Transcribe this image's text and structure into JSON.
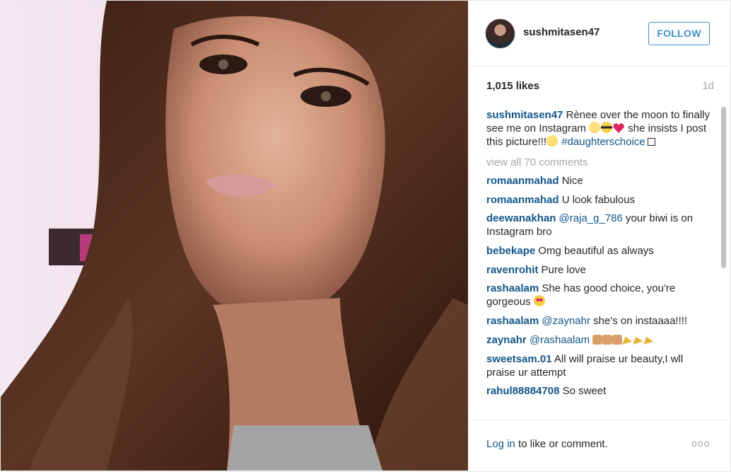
{
  "post": {
    "username": "sushmitasen47",
    "follow_label": "FOLLOW",
    "likes": "1,015 likes",
    "age": "1d",
    "caption": {
      "username": "sushmitasen47",
      "text_1": "Rènee over the moon to finally see me on Instagram ",
      "text_2": " she insists I post this picture!!!",
      "hashtag": "#daughterschoice"
    },
    "view_all": "view all 70 comments"
  },
  "comments": [
    {
      "user": "romaanmahad",
      "text": "Nice"
    },
    {
      "user": "romaanmahad",
      "text": "U look fabulous"
    },
    {
      "user": "deewanakhan",
      "mention": "@raja_g_786",
      "text": " your biwi is on Instagram bro"
    },
    {
      "user": "bebekape",
      "text": "Omg beautiful as always"
    },
    {
      "user": "ravenrohit",
      "text": "Pure love"
    },
    {
      "user": "rashaalam",
      "text": "She has good choice, you're gorgeous "
    },
    {
      "user": "rashaalam",
      "mention": "@zaynahr",
      "text": " she's on instaaaa!!!!"
    },
    {
      "user": "zaynahr",
      "mention": "@rashaalam",
      "text": " "
    },
    {
      "user": "sweetsam.01",
      "text": "All will praise ur beauty,I wll praise ur attempt"
    },
    {
      "user": "rahul88884708",
      "text": "So sweet"
    }
  ],
  "footer": {
    "login_link": "Log in",
    "login_text": " to like or comment.",
    "more": "ooo"
  },
  "icons": {
    "avatar": "profile-avatar",
    "more": "more-options-icon"
  },
  "colors": {
    "link": "#125688",
    "follow": "#3f8fc6",
    "muted": "#a5a7aa"
  }
}
